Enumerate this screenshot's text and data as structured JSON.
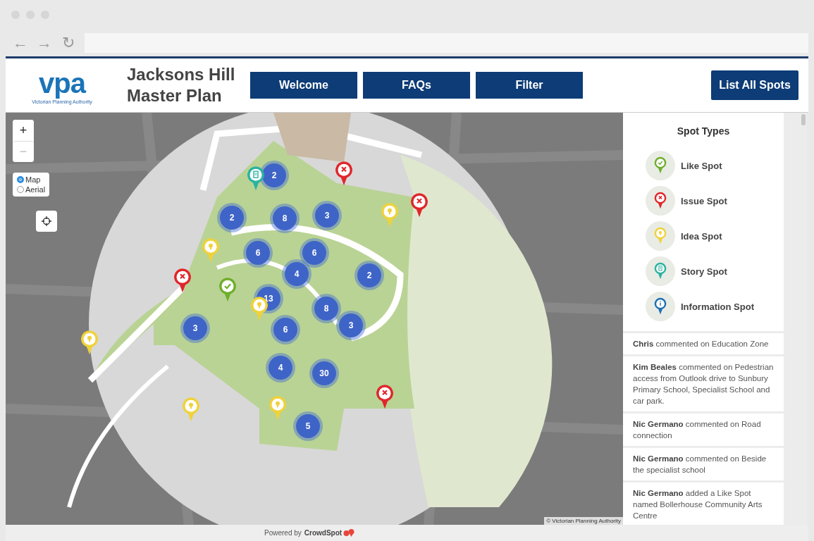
{
  "browser": {
    "back": "←",
    "forward": "→",
    "reload": "↻"
  },
  "header": {
    "logo_mark": "vpa",
    "logo_caption": "Victorian Planning Authority",
    "title": "Jacksons Hill Master Plan",
    "nav": [
      "Welcome",
      "FAQs",
      "Filter"
    ],
    "list_button": "List All Spots"
  },
  "map_controls": {
    "zoom_in": "+",
    "zoom_out": "−",
    "zoom_out_disabled": true,
    "layers": [
      {
        "label": "Map",
        "selected": true
      },
      {
        "label": "Aerial",
        "selected": false
      }
    ]
  },
  "clusters": [
    {
      "count": "2"
    },
    {
      "count": "2"
    },
    {
      "count": "8"
    },
    {
      "count": "3"
    },
    {
      "count": "6"
    },
    {
      "count": "6"
    },
    {
      "count": "4"
    },
    {
      "count": "2"
    },
    {
      "count": "13"
    },
    {
      "count": "8"
    },
    {
      "count": "3"
    },
    {
      "count": "6"
    },
    {
      "count": "3"
    },
    {
      "count": "4"
    },
    {
      "count": "30"
    },
    {
      "count": "5"
    }
  ],
  "pins": [
    {
      "kind": "story"
    },
    {
      "kind": "issue"
    },
    {
      "kind": "issue"
    },
    {
      "kind": "idea"
    },
    {
      "kind": "idea"
    },
    {
      "kind": "issue"
    },
    {
      "kind": "like"
    },
    {
      "kind": "idea"
    },
    {
      "kind": "idea"
    },
    {
      "kind": "issue"
    },
    {
      "kind": "idea"
    },
    {
      "kind": "idea"
    }
  ],
  "attribution": "© Victorian Planning Authority",
  "spot_types": {
    "title": "Spot Types",
    "items": [
      {
        "kind": "like",
        "label": "Like Spot"
      },
      {
        "kind": "issue",
        "label": "Issue Spot"
      },
      {
        "kind": "idea",
        "label": "Idea Spot"
      },
      {
        "kind": "story",
        "label": "Story Spot"
      },
      {
        "kind": "info",
        "label": "Information Spot"
      }
    ]
  },
  "activity": [
    "**Chris** commented on Education Zone",
    "**Kim Beales** commented on Pedestrian access from Outlook drive to Sunbury Primary School, Specialist School and car park.",
    "**Nic Germano** commented on Road connection",
    "**Nic Germano** commented on Beside the specialist school",
    "**Nic Germano** added a Like Spot named Bollerhouse Community Arts Centre"
  ],
  "footer": {
    "powered_by": "Powered by",
    "brand": "CrowdSpot"
  }
}
